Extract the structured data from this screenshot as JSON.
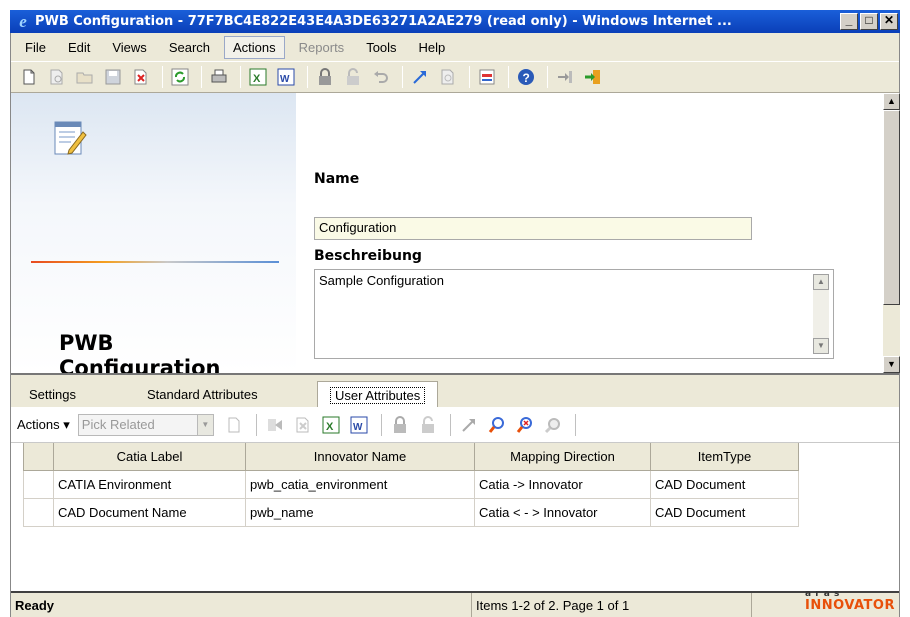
{
  "window": {
    "title": "PWB Configuration - 77F7BC4E822E43E4A3DE63271A2AE279 (read only) - Windows Internet ...",
    "buttons": {
      "minimize": "_",
      "maximize": "□",
      "close": "✕"
    }
  },
  "menu": {
    "items": [
      {
        "label": "File",
        "state": "normal"
      },
      {
        "label": "Edit",
        "state": "normal"
      },
      {
        "label": "Views",
        "state": "normal"
      },
      {
        "label": "Search",
        "state": "normal"
      },
      {
        "label": "Actions",
        "state": "boxed"
      },
      {
        "label": "Reports",
        "state": "disabled"
      },
      {
        "label": "Tools",
        "state": "normal"
      },
      {
        "label": "Help",
        "state": "normal"
      }
    ]
  },
  "toolbar": {
    "icons": [
      "new-document-icon",
      "print-preview-icon",
      "open-folder-icon",
      "save-icon",
      "delete-icon",
      "refresh-icon",
      "print-icon",
      "export-excel-icon",
      "export-word-icon",
      "lock-icon",
      "unlock-icon",
      "undo-icon",
      "promote-icon",
      "where-used-icon",
      "structure-browser-icon",
      "help-icon",
      "dock-icon",
      "exit-icon"
    ]
  },
  "item": {
    "type_title": "PWB Configuration",
    "name_label": "Name",
    "name_value": "Configuration",
    "description_label": "Beschreibung",
    "description_value": "Sample Configuration"
  },
  "tabs": [
    {
      "label": "Settings",
      "active": false
    },
    {
      "label": "Standard Attributes",
      "active": false
    },
    {
      "label": "User Attributes",
      "active": true
    }
  ],
  "relationship_toolbar": {
    "actions_label": "Actions ▾",
    "pick_related": "Pick Related"
  },
  "grid": {
    "columns": [
      "Catia Label",
      "Innovator Name",
      "Mapping Direction",
      "ItemType"
    ],
    "rows": [
      [
        "CATIA Environment",
        "pwb_catia_environment",
        "Catia -> Innovator",
        "CAD Document"
      ],
      [
        "CAD Document Name",
        "pwb_name",
        "Catia < - > Innovator",
        "CAD Document"
      ]
    ]
  },
  "status": {
    "left": "Ready",
    "middle": "Items 1-2 of 2. Page 1 of 1",
    "brand_top": "a r a s",
    "brand": "INNOVATOR"
  },
  "colors": {
    "title_bar": "#0a3fb8",
    "chrome": "#ece9d8",
    "name_field_bg": "#fafae6",
    "brand": "#e8500a"
  }
}
